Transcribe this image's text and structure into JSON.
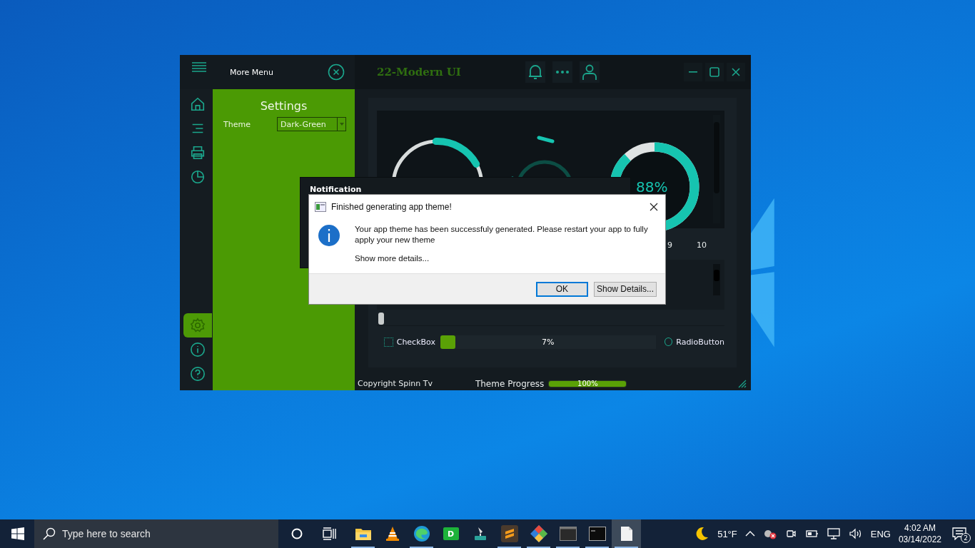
{
  "app": {
    "title": "22-Modern UI",
    "menu": {
      "title": "More Menu"
    },
    "sidebar": {
      "items": [
        {
          "kind": "home",
          "selected": false
        },
        {
          "kind": "list",
          "selected": false
        },
        {
          "kind": "printer",
          "selected": false
        },
        {
          "kind": "chart",
          "selected": false
        },
        {
          "kind": "settings",
          "selected": true
        },
        {
          "kind": "info",
          "selected": false
        },
        {
          "kind": "help",
          "selected": false
        }
      ]
    },
    "settings_panel": {
      "title": "Settings",
      "theme_label": "Theme",
      "theme_value": "Dark-Green"
    },
    "gauge": {
      "reading": "88%"
    },
    "scale_labels": [
      "9",
      "10"
    ],
    "slider": {
      "level": 0
    },
    "checkbox": {
      "label": "CheckBox",
      "checked": false
    },
    "progress": {
      "reading": "7%",
      "level": 0.07
    },
    "radio": {
      "label": "RadioButton",
      "selected": false
    },
    "status_bar": {
      "copyright": "Copyright Spinn Tv",
      "theme_progress_label": "Theme Progress",
      "theme_progress": {
        "reading": "100%",
        "level": 1
      }
    }
  },
  "notification": {
    "title": "Notification"
  },
  "dialog": {
    "title": "Finished generating app theme!",
    "message": "Your app theme has been successfuly generated. Please restart your app to fully apply your new theme",
    "details_link": "Show more details...",
    "buttons": [
      {
        "label": "OK",
        "selected": true
      },
      {
        "label": "Show Details...",
        "selected": false
      }
    ]
  },
  "taskbar": {
    "search": {
      "placeholder": "Type here to search"
    },
    "apps": [
      {
        "kind": "folder",
        "running": true,
        "selected": false
      },
      {
        "kind": "cone",
        "running": false,
        "selected": false
      },
      {
        "kind": "browser",
        "running": true,
        "selected": false
      },
      {
        "kind": "letter",
        "letter": "D",
        "running": false,
        "selected": false
      },
      {
        "kind": "tool",
        "running": false,
        "selected": false
      },
      {
        "kind": "editor",
        "running": true,
        "selected": false
      },
      {
        "kind": "diamond",
        "running": true,
        "selected": false
      },
      {
        "kind": "window",
        "running": true,
        "selected": false
      },
      {
        "kind": "terminal",
        "running": true,
        "selected": false
      },
      {
        "kind": "document",
        "running": true,
        "selected": true
      }
    ],
    "weather": "51°F",
    "language": "ENG",
    "time": "4:02 AM",
    "date": "03/14/2022",
    "notification_count": "2"
  }
}
